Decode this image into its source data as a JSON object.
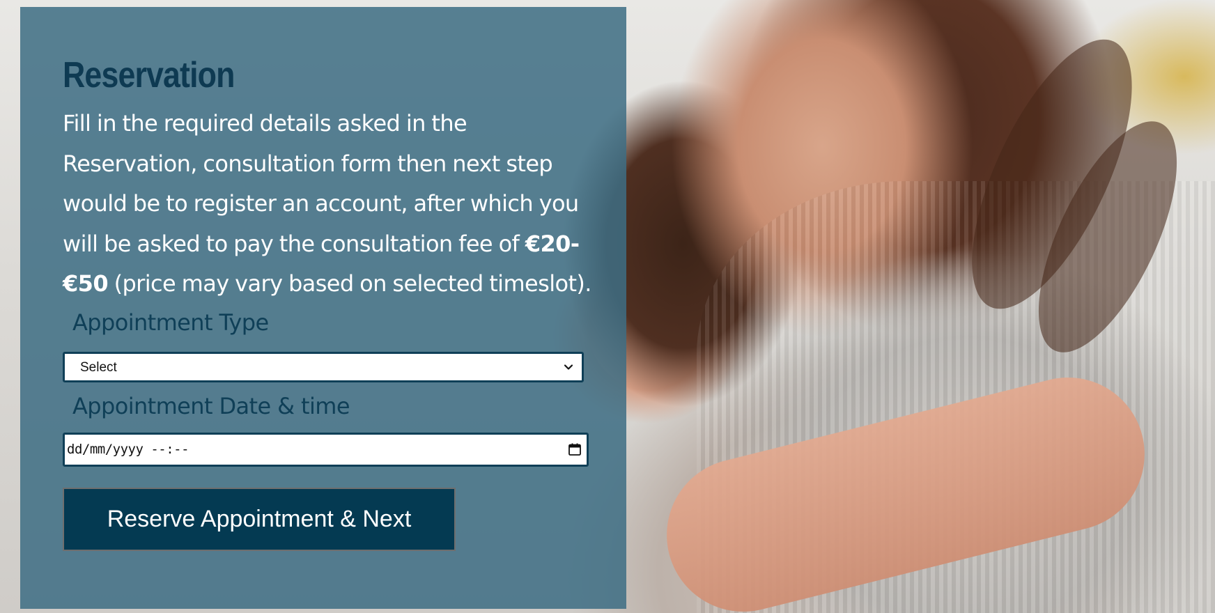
{
  "reservation": {
    "title": "Reservation",
    "intro_text": "Fill in the required details asked in the Reservation, consultation form then next step would be to register an account, after which you will be asked to pay the consultation fee of ",
    "fee_range": "€20-€50",
    "intro_suffix": " (price may vary based on selected timeslot).",
    "appointment_type": {
      "label": "Appointment Type",
      "selected_value": "Select"
    },
    "appointment_datetime": {
      "label": "Appointment Date & time",
      "value": "dd/mm/yyyy --:--"
    },
    "submit_label": "Reserve Appointment & Next"
  },
  "colors": {
    "panel_overlay": "#3e6e84",
    "title_color": "#0e3a52",
    "label_color": "#0f3f57",
    "button_bg": "#043a52"
  },
  "icons": {
    "select_chevron": "chevron-down-icon",
    "date_picker": "calendar-icon"
  }
}
